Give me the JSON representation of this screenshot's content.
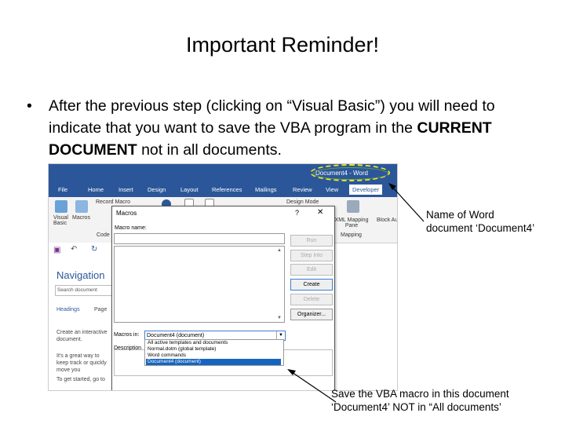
{
  "slide": {
    "title": "Important Reminder!",
    "bullet_char": "•",
    "bullet_part1": "After the previous step (clicking on “Visual Basic”) you will need to indicate that you want to save the VBA program in the ",
    "bullet_bold": "CURRENT DOCUMENT",
    "bullet_part2": " not in all documents."
  },
  "word": {
    "doc_title": "Document4 - Word",
    "tabs": [
      "File",
      "Home",
      "Insert",
      "Design",
      "Layout",
      "References",
      "Mailings",
      "Review",
      "View",
      "Developer"
    ],
    "active_tab": "Developer",
    "ribbon": {
      "visual_basic": "Visual Basic",
      "macros": "Macros",
      "code_group": "Code",
      "record_macro": "Record Macro",
      "design_mode": "Design Mode",
      "xml_mapping_pane": "XML Mapping Pane",
      "mapping_group": "Mapping",
      "block_authors": "Block Authors"
    },
    "nav": {
      "title": "Navigation",
      "search_placeholder": "Search document",
      "tab_headings": "Headings",
      "tab_pages": "Page",
      "text1": "Create an interactive document.",
      "text2": "It's a great way to keep track or quickly move you",
      "text3": "To get started, go to"
    }
  },
  "dialog": {
    "title": "Macros",
    "help": "?",
    "close": "✕",
    "macro_name_label": "Macro name:",
    "buttons": {
      "run": "Run",
      "step_into": "Step Into",
      "edit": "Edit",
      "create": "Create",
      "delete": "Delete",
      "organizer": "Organizer..."
    },
    "macros_in_label": "Macros in:",
    "macros_in_value": "Document4 (document)",
    "description_label": "Description",
    "dropdown_options": [
      "All active templates and documents",
      "Normal.dotm (global template)",
      "Word commands",
      "Document4 (document)"
    ],
    "selected_option": "Document4 (document)"
  },
  "annotations": {
    "doc_name_note": "Name of Word document ‘Document4’",
    "save_note": "Save the VBA macro in this document ‘Document4’ NOT in “All documents’"
  },
  "colors": {
    "word_blue": "#2b579a",
    "highlight_yellow": "#f1e628",
    "selection_blue": "#1565c0"
  }
}
